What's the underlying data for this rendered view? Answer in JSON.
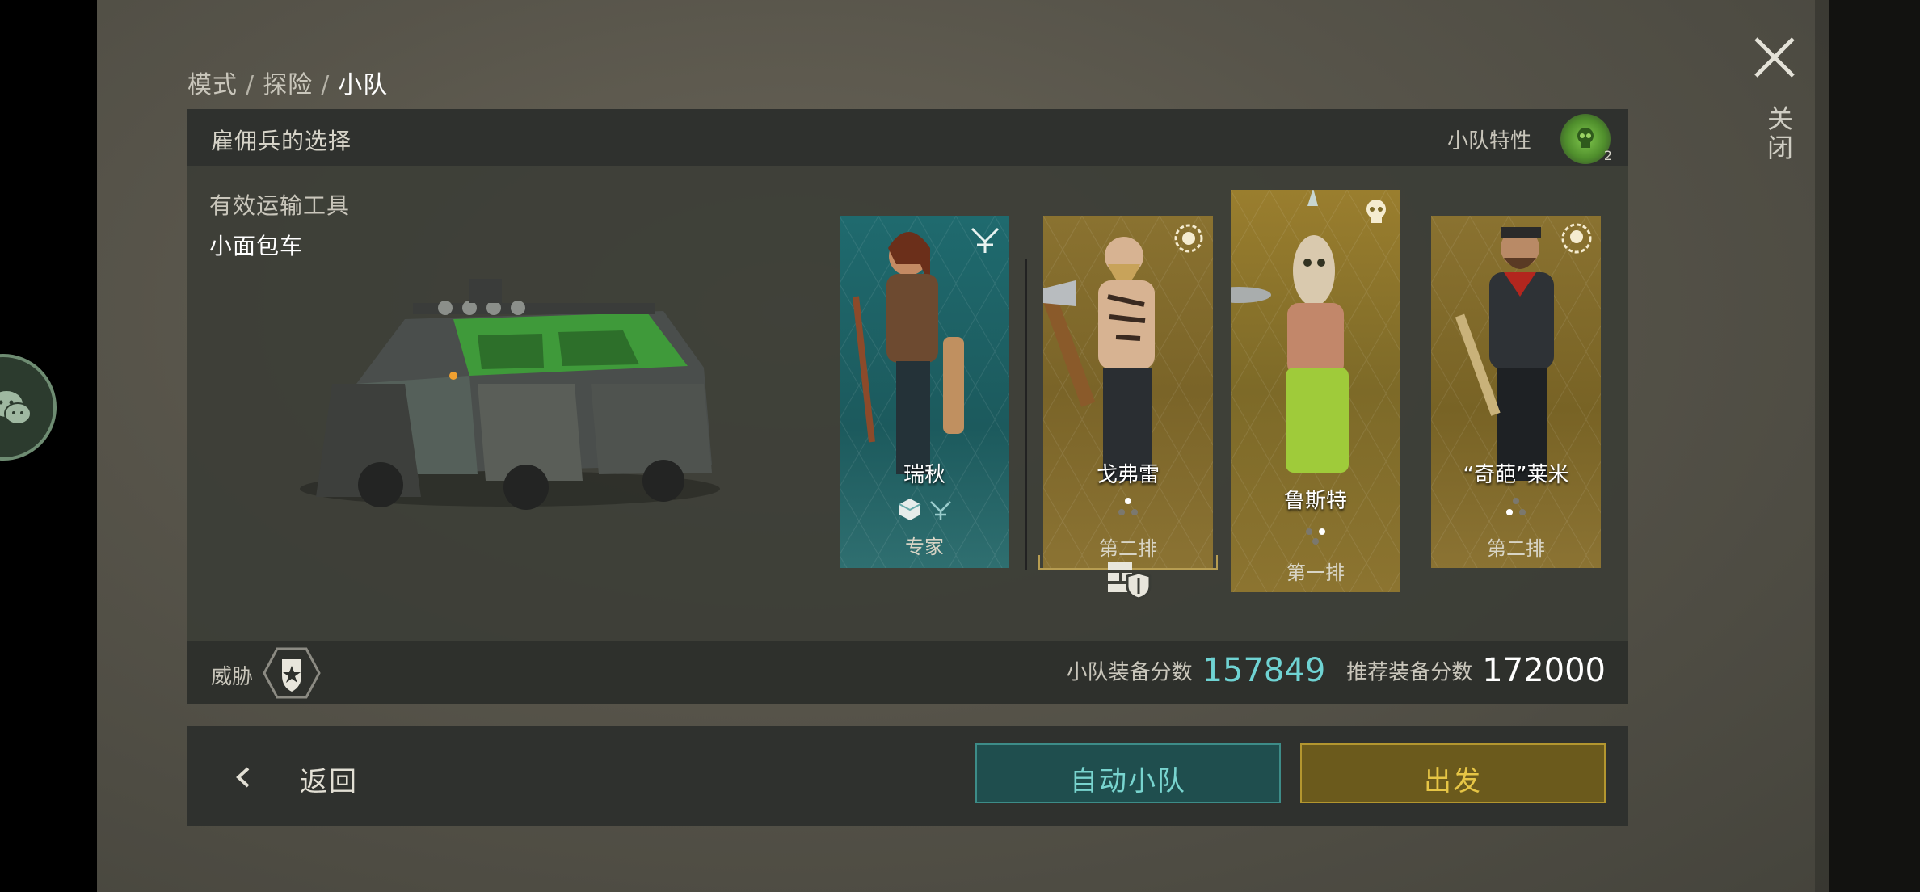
{
  "breadcrumb": {
    "part1": "模式",
    "sep": "/",
    "part2": "探险",
    "current": "小队"
  },
  "close": {
    "label": "关闭"
  },
  "panel": {
    "title": "雇佣兵的选择",
    "squad_trait_label": "小队特性",
    "squad_trait_count": "2",
    "vehicle_label": "有效运输工具",
    "vehicle_name": "小面包车"
  },
  "mercs": [
    {
      "name": "瑞秋",
      "role": "专家",
      "color": "#1f6a6e"
    },
    {
      "name": "戈弗雷",
      "role": "第二排",
      "color": "#8a7230"
    },
    {
      "name": "鲁斯特",
      "role": "第一排",
      "color": "#9a7e2e"
    },
    {
      "name": "“奇葩”莱米",
      "role": "第二排",
      "color": "#8a7230"
    }
  ],
  "stats": {
    "threat_label": "威胁",
    "team_score_label": "小队装备分数",
    "team_score": "157849",
    "recommended_label": "推荐装备分数",
    "recommended_score": "172000"
  },
  "buttons": {
    "back": "返回",
    "auto_squad": "自动小队",
    "depart": "出发"
  },
  "icons": [
    "close-icon",
    "wechat-icon",
    "skull-trait-icon",
    "crossbow-icon",
    "skull-icon",
    "badge-star-icon",
    "back-chevron-icon",
    "shield-wall-icon",
    "cube-icon"
  ],
  "colors": {
    "teal_accent": "#6fd3d3",
    "gold_accent": "#e6c545",
    "expert_teal": "#1f6a6e",
    "gold_card": "#8a7230"
  }
}
